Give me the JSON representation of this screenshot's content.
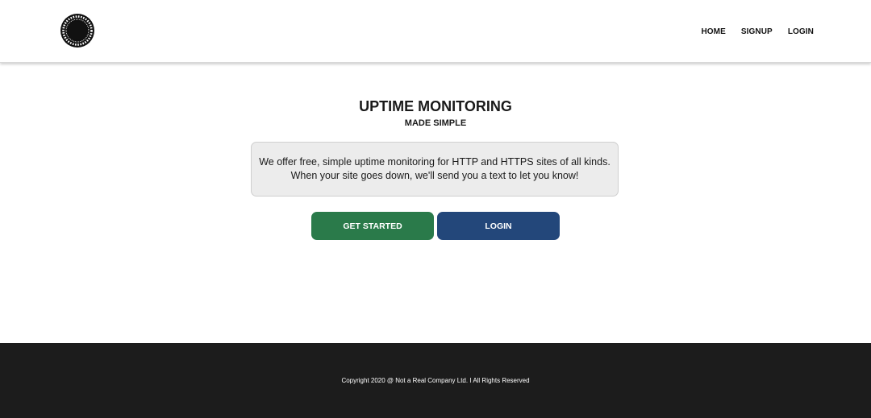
{
  "header": {
    "logo_icon": "circular-badge-icon",
    "nav": {
      "home": "HOME",
      "signup": "SIGNUP",
      "login": "LOGIN"
    }
  },
  "hero": {
    "title": "UPTIME MONITORING",
    "subtitle": "MADE SIMPLE",
    "description_line1": "We offer free, simple uptime monitoring for HTTP and HTTPS sites of all kinds.",
    "description_line2": "When your site goes down, we'll send you a text to let you know!",
    "get_started_label": "GET STARTED",
    "login_label": "LOGIN"
  },
  "footer": {
    "copyright": "Copyright 2020 @ Not a Real Company Ltd. I All Rights Reserved"
  },
  "colors": {
    "get_started": "#2a7a4a",
    "login": "#23477a",
    "footer_bg": "#1c1c1c"
  }
}
